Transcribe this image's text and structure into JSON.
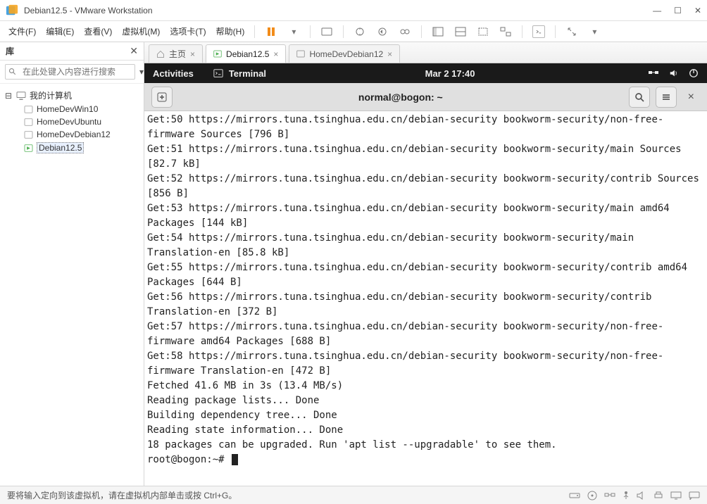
{
  "window": {
    "title": "Debian12.5  - VMware Workstation",
    "min": "—",
    "max": "☐",
    "close": "✕"
  },
  "menubar": {
    "items": [
      "文件(F)",
      "编辑(E)",
      "查看(V)",
      "虚拟机(M)",
      "选项卡(T)",
      "帮助(H)"
    ]
  },
  "sidebar": {
    "title": "库",
    "close": "✕",
    "search_placeholder": "在此处键入内容进行搜索",
    "root": "我的计算机",
    "items": [
      "HomeDevWin10",
      "HomeDevUbuntu",
      "HomeDevDebian12",
      "Debian12.5"
    ]
  },
  "tabs": [
    {
      "label": "主页",
      "type": "home"
    },
    {
      "label": "Debian12.5",
      "type": "run",
      "active": true
    },
    {
      "label": "HomeDevDebian12",
      "type": "run"
    }
  ],
  "gnome": {
    "activities": "Activities",
    "terminal": "Terminal",
    "clock": "Mar 2  17:40"
  },
  "terminal": {
    "title": "normal@bogon: ~",
    "lines": [
      "Get:50 https://mirrors.tuna.tsinghua.edu.cn/debian-security bookworm-security/non-free-firmware Sources [796 B]",
      "Get:51 https://mirrors.tuna.tsinghua.edu.cn/debian-security bookworm-security/main Sources [82.7 kB]",
      "Get:52 https://mirrors.tuna.tsinghua.edu.cn/debian-security bookworm-security/contrib Sources [856 B]",
      "Get:53 https://mirrors.tuna.tsinghua.edu.cn/debian-security bookworm-security/main amd64 Packages [144 kB]",
      "Get:54 https://mirrors.tuna.tsinghua.edu.cn/debian-security bookworm-security/main Translation-en [85.8 kB]",
      "Get:55 https://mirrors.tuna.tsinghua.edu.cn/debian-security bookworm-security/contrib amd64 Packages [644 B]",
      "Get:56 https://mirrors.tuna.tsinghua.edu.cn/debian-security bookworm-security/contrib Translation-en [372 B]",
      "Get:57 https://mirrors.tuna.tsinghua.edu.cn/debian-security bookworm-security/non-free-firmware amd64 Packages [688 B]",
      "Get:58 https://mirrors.tuna.tsinghua.edu.cn/debian-security bookworm-security/non-free-firmware Translation-en [472 B]",
      "Fetched 41.6 MB in 3s (13.4 MB/s)",
      "Reading package lists... Done",
      "Building dependency tree... Done",
      "Reading state information... Done",
      "18 packages can be upgraded. Run 'apt list --upgradable' to see them."
    ],
    "prompt": "root@bogon:~# "
  },
  "statusbar": {
    "hint": "要将输入定向到该虚拟机，请在虚拟机内部单击或按 Ctrl+G。"
  }
}
